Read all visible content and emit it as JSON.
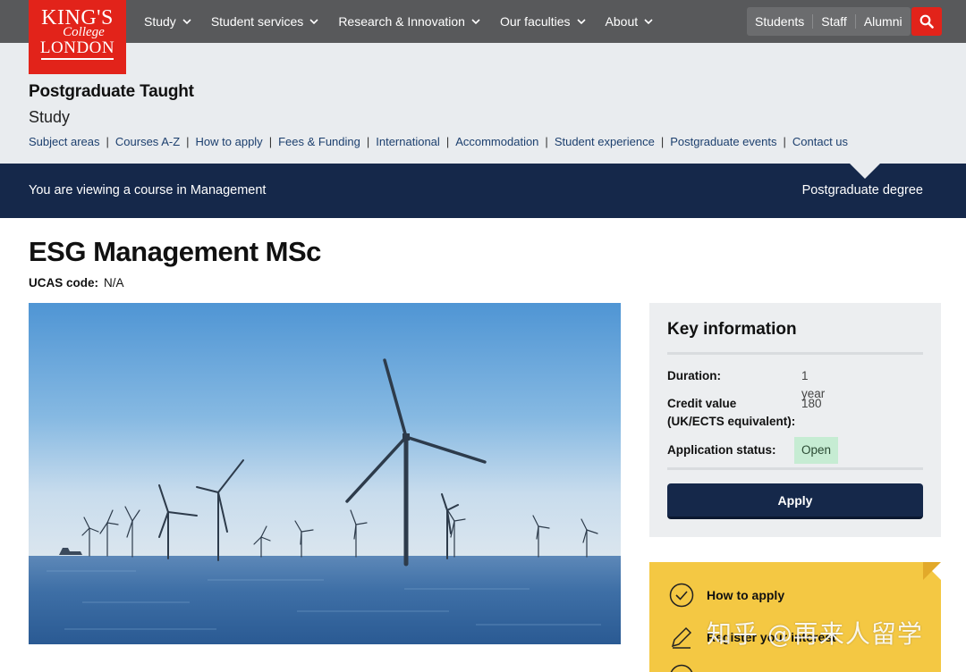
{
  "logo": {
    "line1": "KING'S",
    "line2": "College",
    "line3": "LONDON"
  },
  "nav": {
    "items": [
      {
        "label": "Study"
      },
      {
        "label": "Student services"
      },
      {
        "label": "Research & Innovation"
      },
      {
        "label": "Our faculties"
      },
      {
        "label": "About"
      }
    ],
    "audience": [
      "Students",
      "Staff",
      "Alumni"
    ]
  },
  "section": {
    "title": "Postgraduate Taught",
    "subtitle": "Study",
    "links": [
      "Subject areas",
      "Courses A-Z",
      "How to apply",
      "Fees & Funding",
      "International",
      "Accommodation",
      "Student experience",
      "Postgraduate events",
      "Contact us"
    ]
  },
  "band": {
    "left": "You are viewing a course in Management",
    "right": "Postgraduate degree"
  },
  "course": {
    "title": "ESG Management MSc",
    "ucas_label": "UCAS code:",
    "ucas_value": "N/A"
  },
  "key_info": {
    "title": "Key information",
    "duration_label": "Duration:",
    "duration_value": "1 year",
    "credit_label_1": "Credit value",
    "credit_label_2": "(UK/ECTS equivalent):",
    "credit_value": "180",
    "status_label": "Application status:",
    "status_value": "Open",
    "apply_label": "Apply"
  },
  "how_to": {
    "item1": "How to apply",
    "item2": "Register your interest"
  },
  "watermark": "知乎 @再来人留学",
  "colors": {
    "brand_red": "#e2231a",
    "navy": "#15284a",
    "yellow": "#f4c843",
    "open_green": "#c6ecd3"
  }
}
